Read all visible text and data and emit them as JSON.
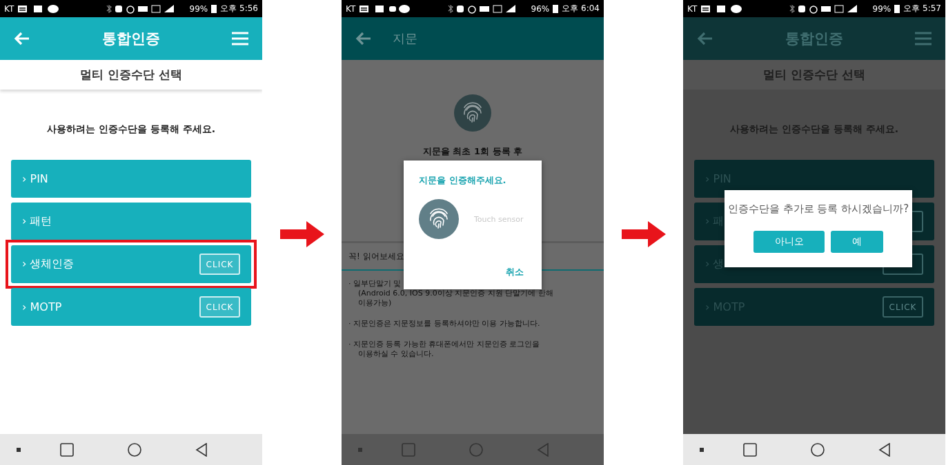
{
  "phones": [
    {
      "status_bar": {
        "carrier": "KT",
        "battery": "99%",
        "time": "오후 5:56"
      },
      "dimmed": false,
      "nav_bar": {
        "dimmed": false
      },
      "screen": {
        "kind": "method-select",
        "app_bar": {
          "title": "통합인증",
          "menu": true
        },
        "subtitle": "멀티 인증수단 선택",
        "prompt": "사용하려는 인증수단을 등록해 주세요.",
        "methods": [
          {
            "label": "› PIN",
            "has_button": false,
            "highlighted": false
          },
          {
            "label": "› 패턴",
            "has_button": false,
            "highlighted": false
          },
          {
            "label": "› 생체인증",
            "has_button": true,
            "button_label": "CLICK",
            "highlighted": true
          },
          {
            "label": "› MOTP",
            "has_button": true,
            "button_label": "CLICK",
            "highlighted": false
          }
        ]
      }
    },
    {
      "status_bar": {
        "carrier": "KT",
        "battery": "96%",
        "time": "오후 6:04"
      },
      "dimmed": true,
      "nav_bar": {
        "dimmed": true
      },
      "screen": {
        "kind": "fingerprint",
        "app_bar": {
          "title": "지문",
          "menu": false
        },
        "intro": "지문을 최초 1회 등록 후",
        "notice_title": "꼭! 읽어보세요",
        "notes": [
          {
            "lines": [
              "· 일부단말기 및",
              "(Android 6.0, IOS 9.0이상 지문인증 지원 단말기에 한해",
              "이용가능)"
            ]
          },
          {
            "lines": [
              "· 지문인증은 지문정보를 등록하셔야만 이용 가능합니다."
            ]
          },
          {
            "lines": [
              "· 지문인증 등록 가능한 휴대폰에서만 지문인증 로그인을",
              "이용하실 수 있습니다."
            ]
          }
        ]
      },
      "dialog": {
        "kind": "fingerprint",
        "title": "지문을 인증해주세요.",
        "hint": "Touch sensor",
        "buttons": [
          "취소"
        ]
      }
    },
    {
      "status_bar": {
        "carrier": "KT",
        "battery": "99%",
        "time": "오후 5:57"
      },
      "dimmed": true,
      "nav_bar": {
        "dimmed": false
      },
      "screen": {
        "kind": "method-select",
        "app_bar": {
          "title": "통합인증",
          "menu": true
        },
        "subtitle": "멀티 인증수단 선택",
        "prompt": "사용하려는 인증수단을 등록해 주세요.",
        "methods": [
          {
            "label": "› PIN",
            "has_button": false,
            "highlighted": false
          },
          {
            "label": "› 패",
            "has_button": true,
            "highlighted": false
          },
          {
            "label": "› 생",
            "has_button": true,
            "highlighted": false
          },
          {
            "label": "› MOTP",
            "has_button": true,
            "button_label": "CLICK",
            "highlighted": false
          }
        ]
      },
      "dialog": {
        "kind": "confirm",
        "message": "인증수단을 추가로 등록 하시겠습니까?",
        "buttons": [
          "아니오",
          "예"
        ]
      }
    }
  ]
}
